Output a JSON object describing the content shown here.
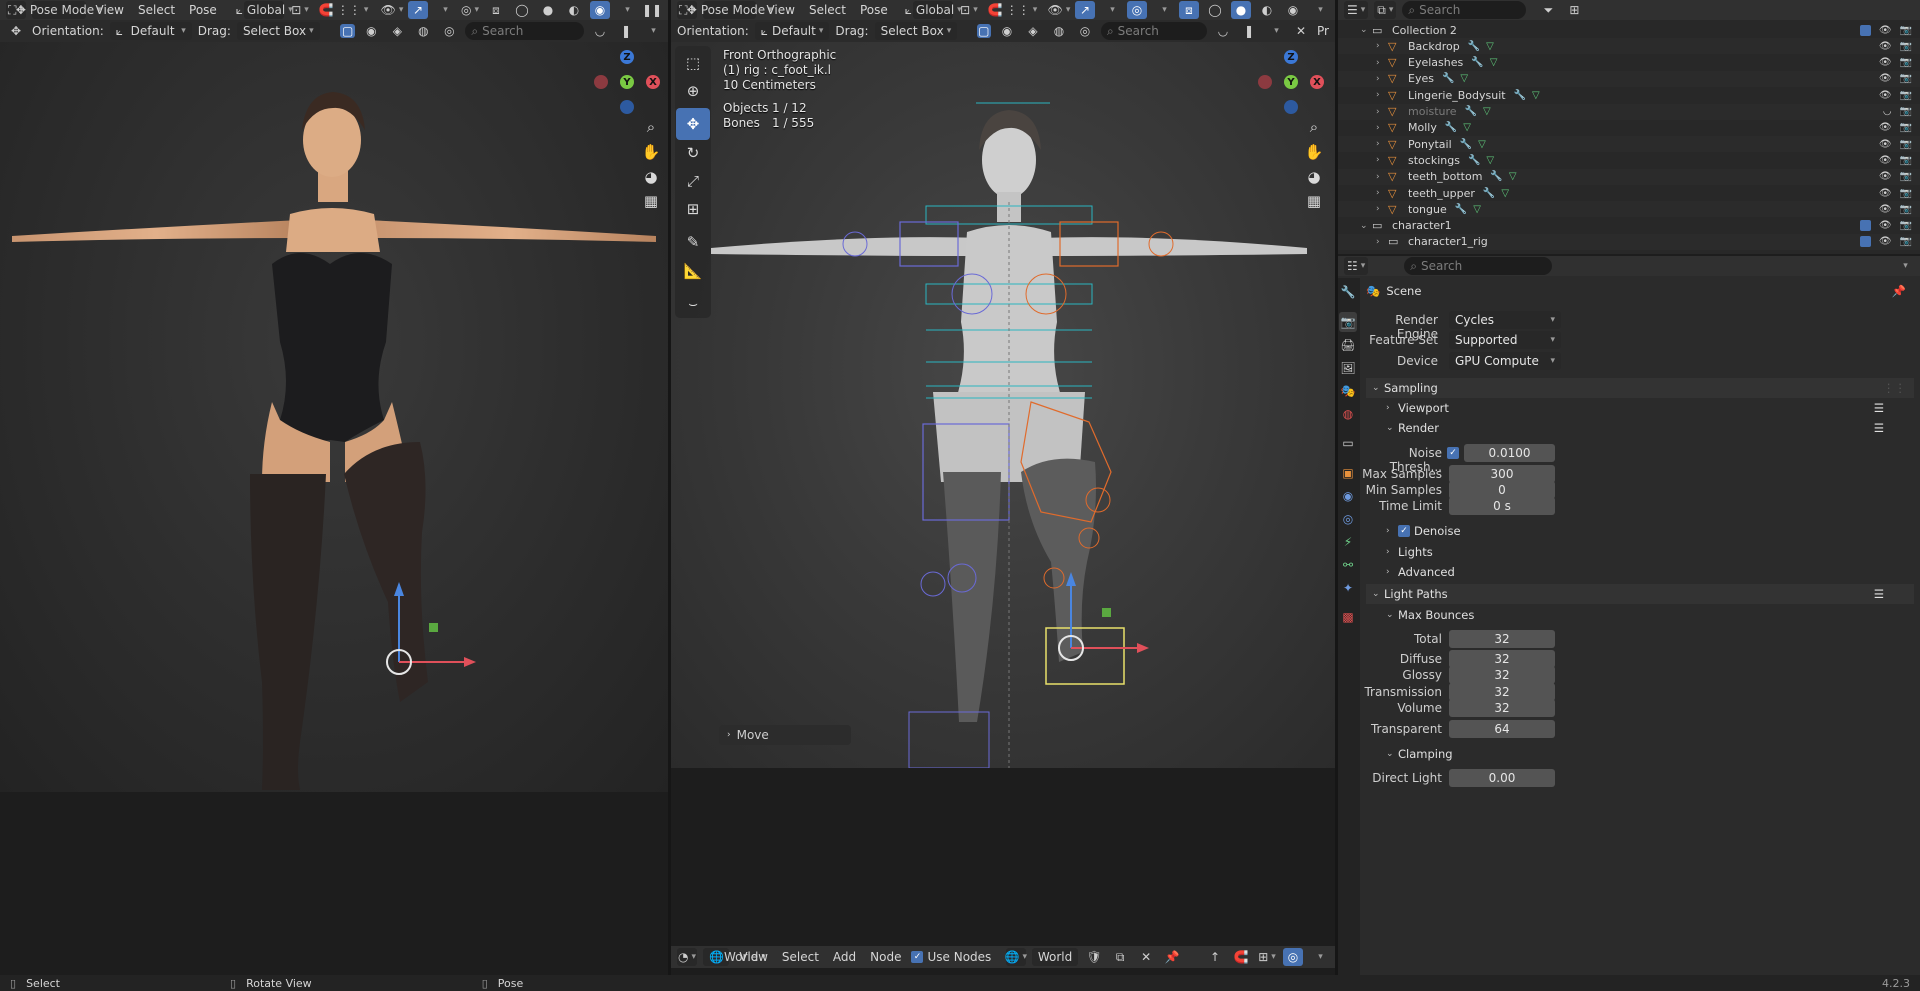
{
  "left_viewport": {
    "header": {
      "mode": "Pose Mode",
      "menus": [
        "View",
        "Select",
        "Pose"
      ],
      "orientation": "Global"
    },
    "toolbar": {
      "orientation_label": "Orientation:",
      "orientation_value": "Default",
      "drag_label": "Drag:",
      "drag_value": "Select Box",
      "search_placeholder": "Search"
    }
  },
  "right_viewport": {
    "header": {
      "mode": "Pose Mode",
      "menus": [
        "View",
        "Select",
        "Pose"
      ],
      "orientation": "Global"
    },
    "toolbar": {
      "orientation_label": "Orientation:",
      "orientation_value": "Default",
      "drag_label": "Drag:",
      "drag_value": "Select Box",
      "search_placeholder": "Search",
      "extra": "Pr"
    },
    "overlay": {
      "view_name": "Front Orthographic",
      "object": "(1) rig : c_foot_ik.l",
      "scale": "10 Centimeters",
      "objects_label": "Objects",
      "objects_value": "1 / 12",
      "bones_label": "Bones",
      "bones_value": "1 / 555"
    },
    "last_op": "Move"
  },
  "node_header": {
    "world_menu": "World",
    "menus": [
      "View",
      "Select",
      "Add",
      "Node"
    ],
    "use_nodes": "Use Nodes",
    "world_name": "World"
  },
  "outliner": {
    "search_placeholder": "Search",
    "items": [
      {
        "name": "Collection 2",
        "level": 0,
        "kind": "collection"
      },
      {
        "name": "Backdrop",
        "level": 1,
        "kind": "object"
      },
      {
        "name": "Eyelashes",
        "level": 1,
        "kind": "object"
      },
      {
        "name": "Eyes",
        "level": 1,
        "kind": "object"
      },
      {
        "name": "Lingerie_Bodysuit",
        "level": 1,
        "kind": "object"
      },
      {
        "name": "moisture",
        "level": 1,
        "kind": "object",
        "dim": true
      },
      {
        "name": "Molly",
        "level": 1,
        "kind": "object"
      },
      {
        "name": "Ponytail",
        "level": 1,
        "kind": "object"
      },
      {
        "name": "stockings",
        "level": 1,
        "kind": "object"
      },
      {
        "name": "teeth_bottom",
        "level": 1,
        "kind": "object"
      },
      {
        "name": "teeth_upper",
        "level": 1,
        "kind": "object"
      },
      {
        "name": "tongue",
        "level": 1,
        "kind": "object"
      },
      {
        "name": "character1",
        "level": 0,
        "kind": "collection"
      },
      {
        "name": "character1_rig",
        "level": 1,
        "kind": "collection"
      }
    ]
  },
  "properties": {
    "search_placeholder": "Search",
    "scene": "Scene",
    "render_engine_label": "Render Engine",
    "render_engine": "Cycles",
    "feature_set_label": "Feature Set",
    "feature_set": "Supported",
    "device_label": "Device",
    "device": "GPU Compute",
    "sampling": "Sampling",
    "viewport": "Viewport",
    "render": "Render",
    "noise_label": "Noise Thresh...",
    "noise_value": "0.0100",
    "max_samples_label": "Max Samples",
    "max_samples": "300",
    "min_samples_label": "Min Samples",
    "min_samples": "0",
    "time_limit_label": "Time Limit",
    "time_limit": "0 s",
    "denoise": "Denoise",
    "lights": "Lights",
    "advanced": "Advanced",
    "light_paths": "Light Paths",
    "max_bounces": "Max Bounces",
    "total_label": "Total",
    "total": "32",
    "diffuse_label": "Diffuse",
    "diffuse": "32",
    "glossy_label": "Glossy",
    "glossy": "32",
    "transmission_label": "Transmission",
    "transmission": "32",
    "volume_label": "Volume",
    "volume": "32",
    "transparent_label": "Transparent",
    "transparent": "64",
    "clamping": "Clamping",
    "direct_light_label": "Direct Light",
    "direct_light": "0.00"
  },
  "status": {
    "select": "Select",
    "rotate": "Rotate View",
    "pose": "Pose",
    "version": "4.2.3"
  }
}
